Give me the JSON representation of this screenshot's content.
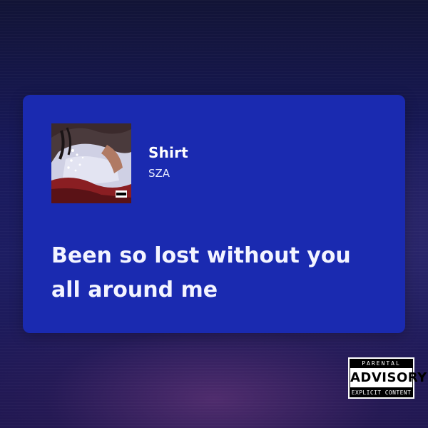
{
  "track": {
    "title": "Shirt",
    "artist": "SZA",
    "lyric": "Been so lost without you all around me",
    "cover_icon": "album-cover-image"
  },
  "advisory": {
    "line1": "PARENTAL",
    "line2": "ADVISORY",
    "line3": "EXPLICIT CONTENT"
  },
  "colors": {
    "card": "#1a2ab0",
    "background": "#18195a",
    "text": "#ffffff"
  }
}
